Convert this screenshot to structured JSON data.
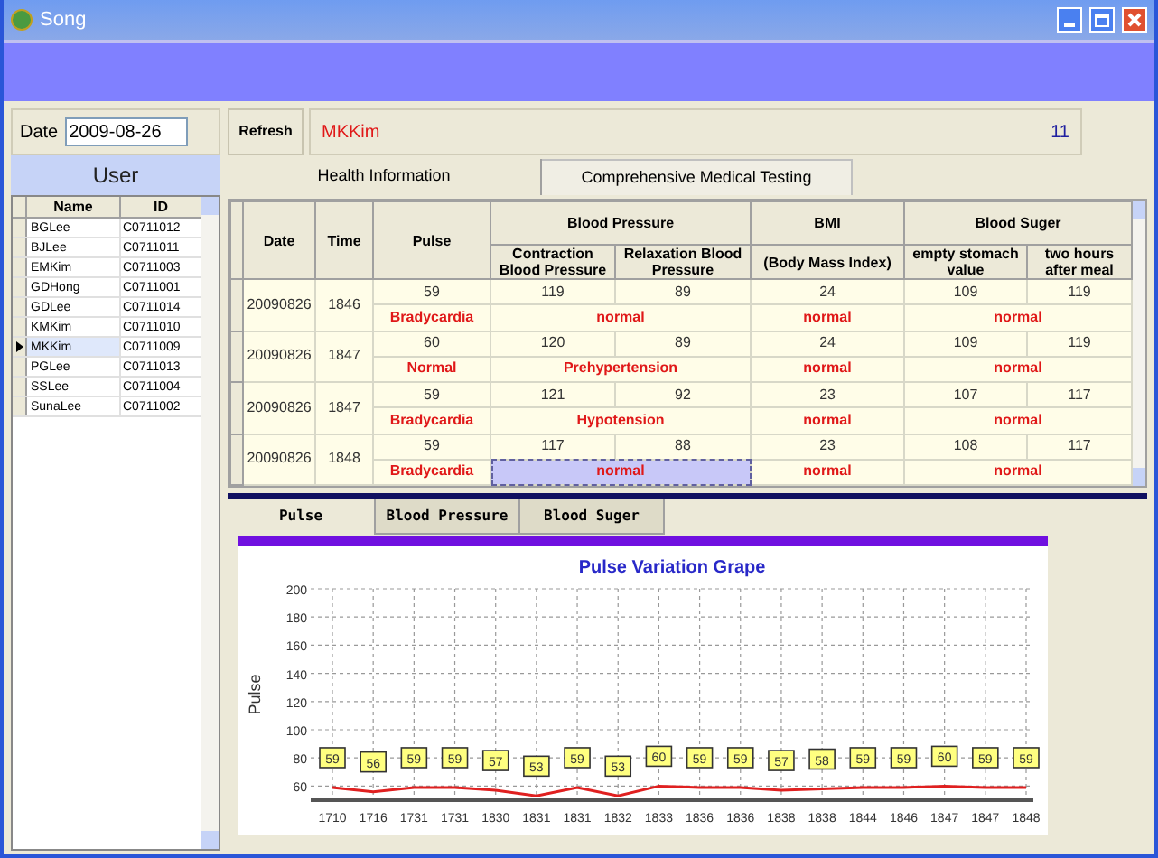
{
  "window": {
    "title": "Song"
  },
  "date_field": {
    "label": "Date",
    "value": "2009-08-26"
  },
  "user_panel": {
    "title": "User",
    "columns": [
      "Name",
      "ID"
    ],
    "rows": [
      {
        "name": "BGLee",
        "id": "C0711012",
        "selected": false
      },
      {
        "name": "BJLee",
        "id": "C0711011",
        "selected": false
      },
      {
        "name": "EMKim",
        "id": "C0711003",
        "selected": false
      },
      {
        "name": "GDHong",
        "id": "C0711001",
        "selected": false
      },
      {
        "name": "GDLee",
        "id": "C0711014",
        "selected": false
      },
      {
        "name": "KMKim",
        "id": "C0711010",
        "selected": false
      },
      {
        "name": "MKKim",
        "id": "C0711009",
        "selected": true
      },
      {
        "name": "PGLee",
        "id": "C0711013",
        "selected": false
      },
      {
        "name": "SSLee",
        "id": "C0711004",
        "selected": false
      },
      {
        "name": "SunaLee",
        "id": "C0711002",
        "selected": false
      }
    ]
  },
  "toolbar": {
    "refresh": "Refresh",
    "user": "MKKim",
    "count": "11"
  },
  "tabs": [
    {
      "label": "Health Information",
      "selected": true
    },
    {
      "label": "Comprehensive Medical Testing",
      "selected": false
    }
  ],
  "health_table": {
    "headers": {
      "date": "Date",
      "time": "Time",
      "pulse": "Pulse",
      "blood_pressure": "Blood Pressure",
      "contraction": "Contraction Blood Pressure",
      "relaxation": "Relaxation Blood Pressure",
      "bmi": "BMI",
      "bmi_full": "(Body Mass Index)",
      "blood_sugar": "Blood Suger",
      "empty_stomach": "empty stomach value",
      "after_meal": "two hours after meal"
    },
    "rows": [
      {
        "date": "20090826",
        "time": "1846",
        "pulse": "59",
        "contraction": "119",
        "relaxation": "89",
        "bmi": "24",
        "empty_stomach": "109",
        "after_meal": "119",
        "pulse_status": "Bradycardia",
        "bp_status": {
          "text": "normal",
          "selected": false
        },
        "bmi_status": "normal",
        "sugar_status": "normal"
      },
      {
        "date": "20090826",
        "time": "1847",
        "pulse": "60",
        "contraction": "120",
        "relaxation": "89",
        "bmi": "24",
        "empty_stomach": "109",
        "after_meal": "119",
        "pulse_status": "Normal",
        "bp_status": {
          "text": "Prehypertension",
          "selected": false
        },
        "bmi_status": "normal",
        "sugar_status": "normal"
      },
      {
        "date": "20090826",
        "time": "1847",
        "pulse": "59",
        "contraction": "121",
        "relaxation": "92",
        "bmi": "23",
        "empty_stomach": "107",
        "after_meal": "117",
        "pulse_status": "Bradycardia",
        "bp_status": {
          "text": "Hypotension",
          "selected": false
        },
        "bmi_status": "normal",
        "sugar_status": "normal"
      },
      {
        "date": "20090826",
        "time": "1848",
        "pulse": "59",
        "contraction": "117",
        "relaxation": "88",
        "bmi": "23",
        "empty_stomach": "108",
        "after_meal": "117",
        "pulse_status": "Bradycardia",
        "bp_status": {
          "text": "normal",
          "selected": true
        },
        "bmi_status": "normal",
        "sugar_status": "normal"
      }
    ]
  },
  "chart_tabs": [
    {
      "label": "Pulse",
      "selected": true
    },
    {
      "label": "Blood Pressure",
      "selected": false
    },
    {
      "label": "Blood Suger",
      "selected": false
    }
  ],
  "chart_panel": {
    "chart_data": {
      "type": "line",
      "title": "Pulse Variation Grape",
      "ylabel": "Pulse",
      "categories": [
        "1710",
        "1716",
        "1731",
        "1731",
        "1830",
        "1831",
        "1831",
        "1832",
        "1833",
        "1836",
        "1836",
        "1838",
        "1838",
        "1844",
        "1846",
        "1847",
        "1847",
        "1848"
      ],
      "series": [
        {
          "color": "#e02020",
          "values": [
            59,
            56,
            59,
            59,
            57,
            53,
            59,
            53,
            60,
            59,
            59,
            57,
            58,
            59,
            59,
            60,
            59,
            59
          ]
        }
      ],
      "ylim": [
        50,
        200
      ],
      "yticks": [
        60,
        80,
        100,
        120,
        140,
        160,
        180,
        200
      ],
      "data_labels": true,
      "grid": true
    }
  }
}
